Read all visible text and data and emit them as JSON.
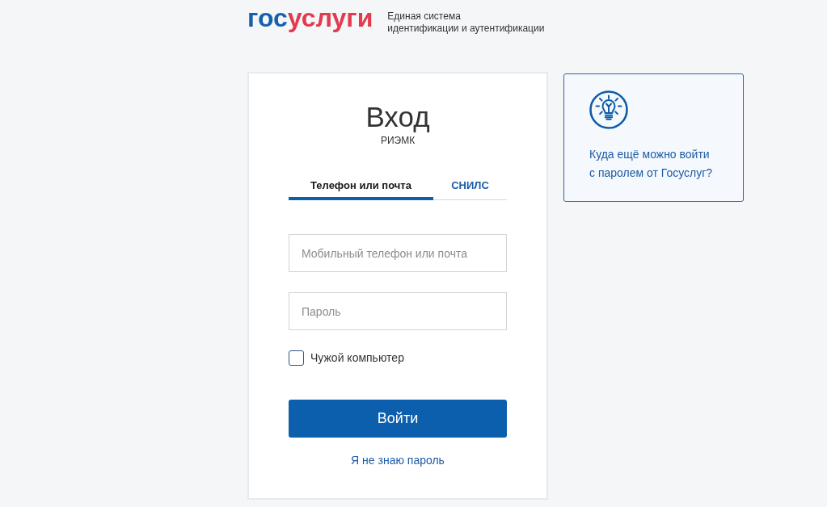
{
  "header": {
    "logo": [
      {
        "text": "гос",
        "color": "#1760ae"
      },
      {
        "text": "услуги",
        "color": "#e43a4f"
      }
    ],
    "tagline": [
      "Единая система",
      "идентификации и аутентификации"
    ]
  },
  "login": {
    "title": "Вход",
    "subtitle": "РИЭМК",
    "tabs": [
      {
        "label": "Телефон или почта",
        "selected": true
      },
      {
        "label": "СНИЛС",
        "selected": false
      }
    ],
    "fields": [
      {
        "placeholder": "Мобильный телефон или почта"
      },
      {
        "placeholder": "Пароль"
      }
    ],
    "remember": {
      "label": "Чужой компьютер",
      "checked": false
    },
    "submit": "Войти",
    "forgot_link": "Я не знаю пароль"
  },
  "hint": {
    "link": "Куда ещё можно войти с паролем от Госуслуг?"
  }
}
